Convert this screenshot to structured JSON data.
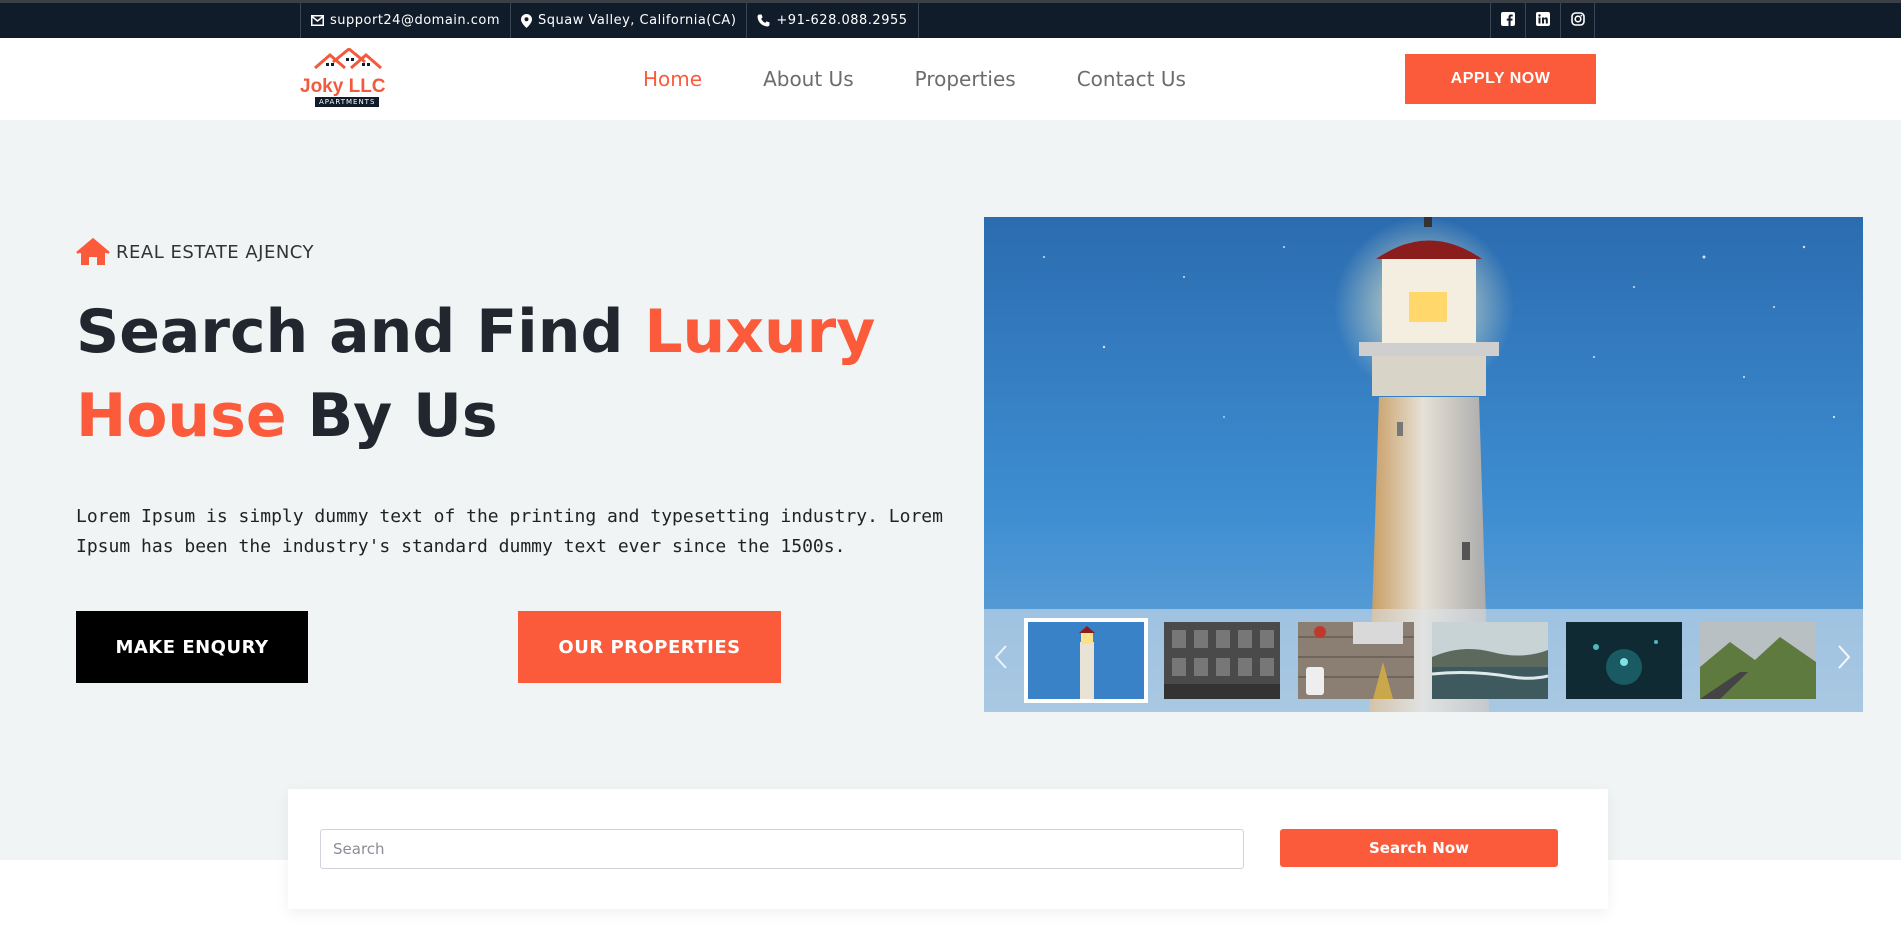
{
  "topbar": {
    "email": "support24@domain.com",
    "location": "Squaw Valley, California(CA)",
    "phone": "+91-628.088.2955",
    "icons": [
      "envelope-icon",
      "map-marker-icon",
      "phone-icon"
    ],
    "social": [
      "facebook-icon",
      "linkedin-icon",
      "instagram-icon"
    ]
  },
  "header": {
    "logo_text": "Joky LLC",
    "logo_tag": "APARTMENTS",
    "nav": [
      {
        "label": "Home",
        "active": true
      },
      {
        "label": "About Us",
        "active": false
      },
      {
        "label": "Properties",
        "active": false
      },
      {
        "label": "Contact Us",
        "active": false
      }
    ],
    "apply_label": "APPLY NOW"
  },
  "hero": {
    "eyebrow": "REAL ESTATE AJENCY",
    "headline": {
      "part1": "Search and Find ",
      "accent1": "Luxury",
      "accent2": "House",
      "part2": " By Us"
    },
    "description": "Lorem Ipsum is simply dummy text of the printing and typesetting industry. Lorem Ipsum has been the industry's standard dummy text ever since the 1500s.",
    "enquiry_label": "MAKE ENQURY",
    "properties_label": "OUR PROPERTIES"
  },
  "slider": {
    "thumbnails": [
      "lighthouse",
      "building",
      "desk-flatlay",
      "coast",
      "water-drops",
      "mountain-road"
    ],
    "active_index": 0
  },
  "search": {
    "placeholder": "Search",
    "button_label": "Search Now"
  },
  "colors": {
    "accent": "#fb5b3b",
    "topbar": "#111c2a",
    "hero_bg": "#f1f4f5",
    "dark_text": "#22262e"
  }
}
